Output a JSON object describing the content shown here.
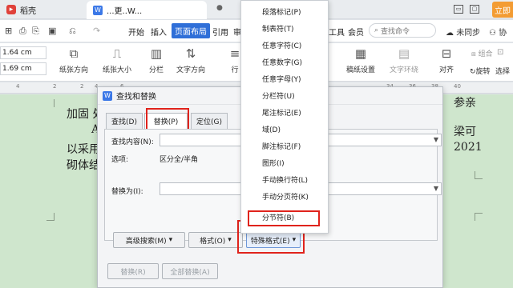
{
  "tabs": [
    {
      "label": "稻壳"
    },
    {
      "label": "...更..W..."
    }
  ],
  "titlebar": {
    "window_buttons": [
      "▭",
      "▢"
    ],
    "login_label": "立即"
  },
  "quick_access": [
    "⊞",
    "⎙",
    "⎌",
    "↷"
  ],
  "menu": {
    "items": [
      "开始",
      "插入",
      "页面布局",
      "引用",
      "审",
      "工具",
      "会员"
    ],
    "active": "页面布局",
    "search_placeholder": "查找命令",
    "sync_label": "未同步",
    "extra_label": "协"
  },
  "ribbon": {
    "margin_top": "1.64 cm",
    "margin_bottom": "1.69 cm",
    "tools": [
      "纸张方向",
      "纸张大小",
      "分栏",
      "文字方向",
      "行",
      "稿纸设置",
      "文字环绕",
      "对齐",
      "旋转",
      "选择"
    ],
    "right_small": [
      "组合",
      "⊡"
    ]
  },
  "ruler": {
    "ticks": [
      "4",
      "2",
      "2",
      "4",
      "6",
      "34",
      "36",
      "38",
      "40"
    ]
  },
  "document": {
    "lines": [
      "加固 处",
      "A",
      "以采用",
      "砌体结"
    ],
    "right_texts": [
      "梁可",
      "2021"
    ],
    "right_partial": "参亲"
  },
  "dialog": {
    "title": "查找和替换",
    "tabs": [
      "查找(D)",
      "替换(P)",
      "定位(G)"
    ],
    "active_tab": "替换(P)",
    "find_label": "查找内容(N):",
    "find_value": "",
    "options_label": "选项:",
    "options_value": "区分全/半角",
    "replace_label": "替换为(I):",
    "replace_value": "",
    "buttons": {
      "advanced": "高级搜索(M)",
      "format": "格式(O)",
      "special": "特殊格式(E)",
      "replace": "替换(R)",
      "replace_all": "全部替换(A)"
    }
  },
  "special_menu": {
    "items": [
      "段落标记(P)",
      "制表符(T)",
      "任意字符(C)",
      "任意数字(G)",
      "任意字母(Y)",
      "分栏符(U)",
      "尾注标记(E)",
      "域(D)",
      "脚注标记(F)",
      "图形(I)",
      "手动换行符(L)",
      "手动分页符(K)",
      "分节符(B)"
    ],
    "highlighted": "分节符(B)"
  },
  "highlight_color": "#e0231c",
  "accent_color": "#2f6fd8"
}
